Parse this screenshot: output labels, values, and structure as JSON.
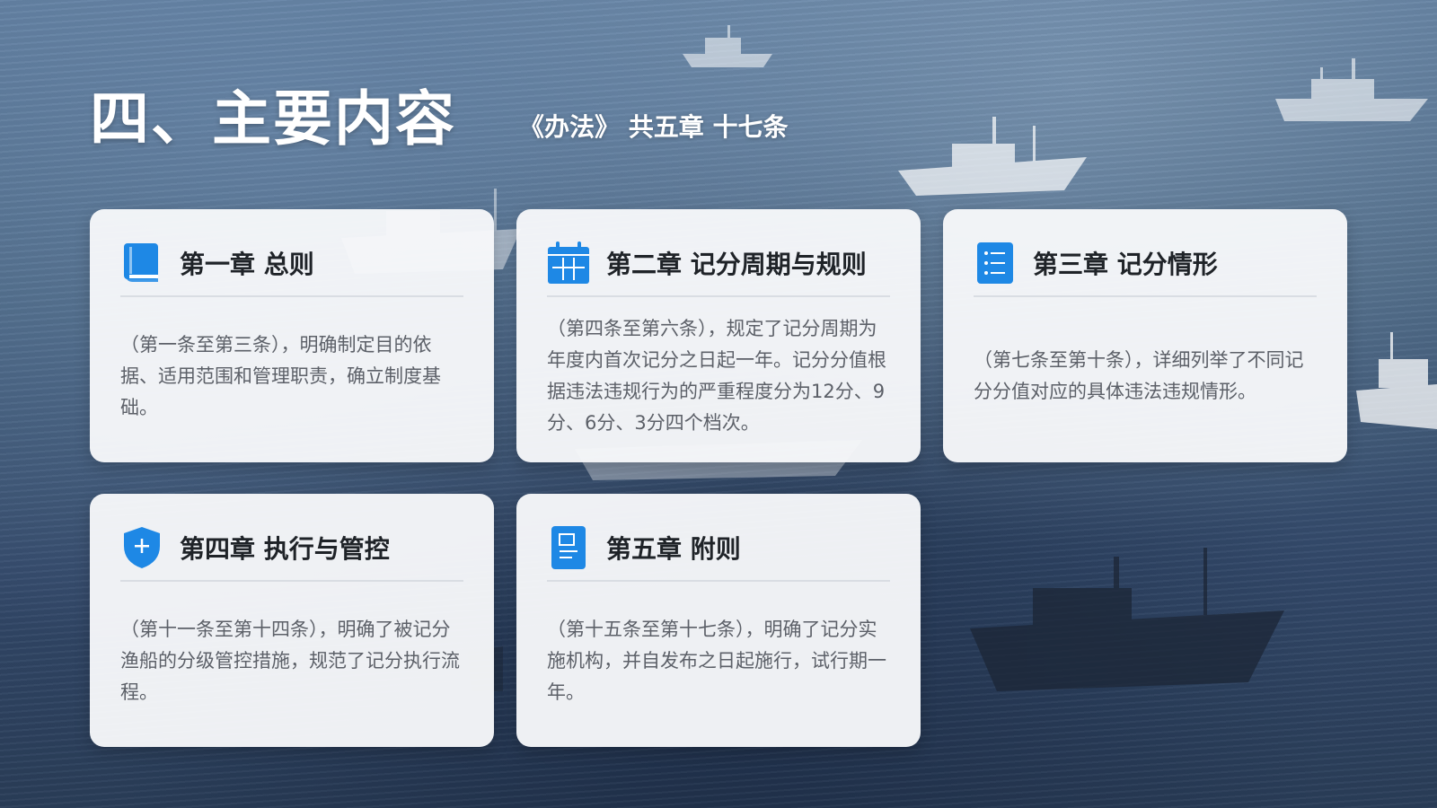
{
  "header": {
    "title": "四、主要内容",
    "subtitle": "《办法》 共五章 十七条"
  },
  "cards": [
    {
      "icon": "book-icon",
      "title": "第一章 总则",
      "body": "（第一条至第三条），明确制定目的依据、适用范围和管理职责，确立制度基础。"
    },
    {
      "icon": "calendar-icon",
      "title": "第二章 记分周期与规则",
      "body": "（第四条至第六条），规定了记分周期为年度内首次记分之日起一年。记分分值根据违法违规行为的严重程度分为12分、9分、6分、3分四个档次。"
    },
    {
      "icon": "list-icon",
      "title": "第三章 记分情形",
      "body": "（第七条至第十条），详细列举了不同记分分值对应的具体违法违规情形。"
    },
    {
      "icon": "shield-icon",
      "title": "第四章 执行与管控",
      "body": "（第十一条至第十四条），明确了被记分渔船的分级管控措施，规范了记分执行流程。"
    },
    {
      "icon": "document-icon",
      "title": "第五章 附则",
      "body": "（第十五条至第十七条），明确了记分实施机构，并自发布之日起施行，试行期一年。"
    }
  ],
  "colors": {
    "accent": "#1e88e5",
    "card_bg": "#f7f8fa",
    "title_text": "#1f2328",
    "body_text": "#5c6068"
  }
}
